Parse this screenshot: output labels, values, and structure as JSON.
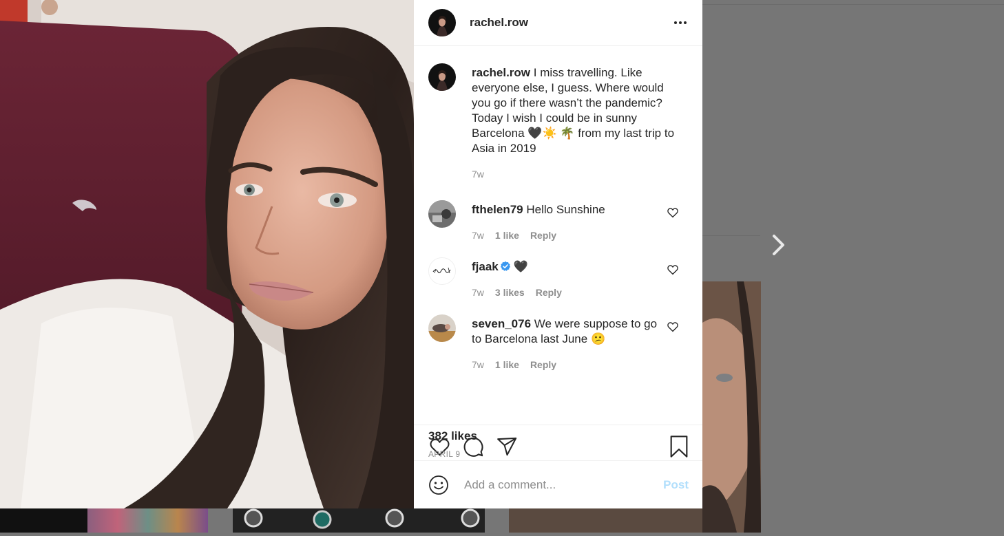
{
  "post": {
    "username": "rachel.row",
    "caption": "I miss travelling. Like everyone else, I guess. Where would you go if there wasn’t the pandemic? Today I wish I could be in sunny Barcelona 🖤☀️ 🌴 from my last trip to Asia in 2019",
    "caption_age": "7w",
    "likes": "382 likes",
    "date": "APRIL 9"
  },
  "comments": [
    {
      "username": "fthelen79",
      "text": "Hello Sunshine",
      "age": "7w",
      "likes": "1 like",
      "reply": "Reply"
    },
    {
      "username": "fjaak",
      "verified": true,
      "text": "🖤",
      "age": "7w",
      "likes": "3 likes",
      "reply": "Reply"
    },
    {
      "username": "seven_076",
      "text": "We were suppose to go to Barcelona last June 😕",
      "age": "7w",
      "likes": "1 like",
      "reply": "Reply"
    }
  ],
  "comment_box": {
    "placeholder": "Add a comment...",
    "post_label": "Post"
  },
  "icons": {
    "more": "more-options-icon",
    "like": "heart-icon",
    "comment": "comment-bubble-icon",
    "share": "paper-plane-icon",
    "save": "bookmark-icon",
    "emoji": "smiley-icon",
    "next": "chevron-right-icon",
    "verified": "verified-badge-icon"
  },
  "colors": {
    "post_button": "#b2dffc",
    "verified": "#3897f0",
    "meta_text": "#8e8e8e"
  }
}
